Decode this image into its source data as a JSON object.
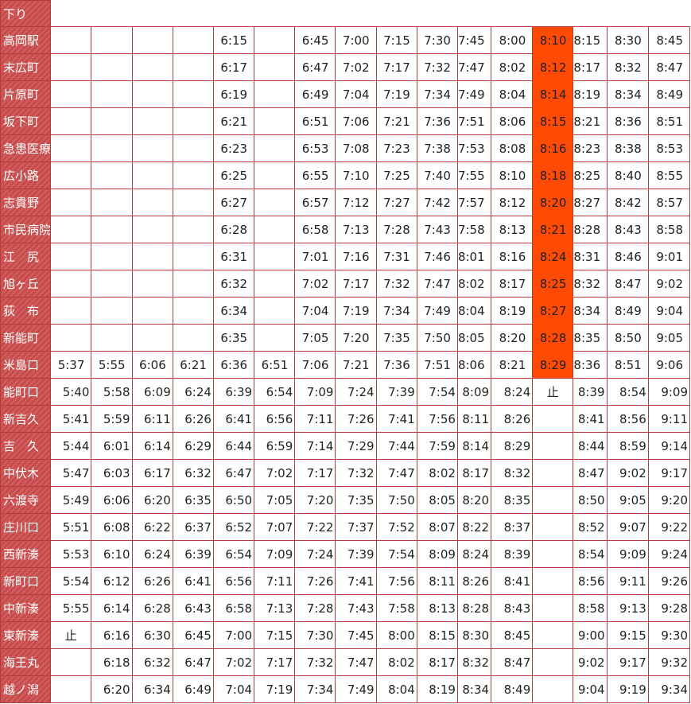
{
  "header": {
    "direction_label": "下り"
  },
  "stations": [
    "高岡駅",
    "末広町",
    "片原町",
    "坂下町",
    "急患医療",
    "広小路",
    "志貴野",
    "市民病院",
    "江　尻",
    "旭ヶ丘",
    "荻　布",
    "新能町",
    "米島口",
    "能町口",
    "新吉久",
    "吉　久",
    "中伏木",
    "六渡寺",
    "庄川口",
    "西新湊",
    "新町口",
    "中新湊",
    "東新湊",
    "海王丸",
    "越ノ潟"
  ],
  "rows": [
    [
      "",
      "",
      "",
      "",
      "6:15",
      "",
      "6:45",
      "7:00",
      "7:15",
      "7:30",
      "7:45",
      "8:00",
      "8:10",
      "8:15",
      "8:30",
      "8:45"
    ],
    [
      "",
      "",
      "",
      "",
      "6:17",
      "",
      "6:47",
      "7:02",
      "7:17",
      "7:32",
      "7:47",
      "8:02",
      "8:12",
      "8:17",
      "8:32",
      "8:47"
    ],
    [
      "",
      "",
      "",
      "",
      "6:19",
      "",
      "6:49",
      "7:04",
      "7:19",
      "7:34",
      "7:49",
      "8:04",
      "8:14",
      "8:19",
      "8:34",
      "8:49"
    ],
    [
      "",
      "",
      "",
      "",
      "6:21",
      "",
      "6:51",
      "7:06",
      "7:21",
      "7:36",
      "7:51",
      "8:06",
      "8:15",
      "8:21",
      "8:36",
      "8:51"
    ],
    [
      "",
      "",
      "",
      "",
      "6:23",
      "",
      "6:53",
      "7:08",
      "7:23",
      "7:38",
      "7:53",
      "8:08",
      "8:16",
      "8:23",
      "8:38",
      "8:53"
    ],
    [
      "",
      "",
      "",
      "",
      "6:25",
      "",
      "6:55",
      "7:10",
      "7:25",
      "7:40",
      "7:55",
      "8:10",
      "8:18",
      "8:25",
      "8:40",
      "8:55"
    ],
    [
      "",
      "",
      "",
      "",
      "6:27",
      "",
      "6:57",
      "7:12",
      "7:27",
      "7:42",
      "7:57",
      "8:12",
      "8:20",
      "8:27",
      "8:42",
      "8:57"
    ],
    [
      "",
      "",
      "",
      "",
      "6:28",
      "",
      "6:58",
      "7:13",
      "7:28",
      "7:43",
      "7:58",
      "8:13",
      "8:21",
      "8:28",
      "8:43",
      "8:58"
    ],
    [
      "",
      "",
      "",
      "",
      "6:31",
      "",
      "7:01",
      "7:16",
      "7:31",
      "7:46",
      "8:01",
      "8:16",
      "8:24",
      "8:31",
      "8:46",
      "9:01"
    ],
    [
      "",
      "",
      "",
      "",
      "6:32",
      "",
      "7:02",
      "7:17",
      "7:32",
      "7:47",
      "8:02",
      "8:17",
      "8:25",
      "8:32",
      "8:47",
      "9:02"
    ],
    [
      "",
      "",
      "",
      "",
      "6:34",
      "",
      "7:04",
      "7:19",
      "7:34",
      "7:49",
      "8:04",
      "8:19",
      "8:27",
      "8:34",
      "8:49",
      "9:04"
    ],
    [
      "",
      "",
      "",
      "",
      "6:35",
      "",
      "7:05",
      "7:20",
      "7:35",
      "7:50",
      "8:05",
      "8:20",
      "8:28",
      "8:35",
      "8:50",
      "9:05"
    ],
    [
      "5:37",
      "5:55",
      "6:06",
      "6:21",
      "6:36",
      "6:51",
      "7:06",
      "7:21",
      "7:36",
      "7:51",
      "8:06",
      "8:21",
      "8:29",
      "8:36",
      "8:51",
      "9:06"
    ],
    [
      "5:40",
      "5:58",
      "6:09",
      "6:24",
      "6:39",
      "6:54",
      "7:09",
      "7:24",
      "7:39",
      "7:54",
      "8:09",
      "8:24",
      "止",
      "8:39",
      "8:54",
      "9:09"
    ],
    [
      "5:41",
      "5:59",
      "6:11",
      "6:26",
      "6:41",
      "6:56",
      "7:11",
      "7:26",
      "7:41",
      "7:56",
      "8:11",
      "8:26",
      "",
      "8:41",
      "8:56",
      "9:11"
    ],
    [
      "5:44",
      "6:01",
      "6:14",
      "6:29",
      "6:44",
      "6:59",
      "7:14",
      "7:29",
      "7:44",
      "7:59",
      "8:14",
      "8:29",
      "",
      "8:44",
      "8:59",
      "9:14"
    ],
    [
      "5:47",
      "6:03",
      "6:17",
      "6:32",
      "6:47",
      "7:02",
      "7:17",
      "7:32",
      "7:47",
      "8:02",
      "8:17",
      "8:32",
      "",
      "8:47",
      "9:02",
      "9:17"
    ],
    [
      "5:49",
      "6:06",
      "6:20",
      "6:35",
      "6:50",
      "7:05",
      "7:20",
      "7:35",
      "7:50",
      "8:05",
      "8:20",
      "8:35",
      "",
      "8:50",
      "9:05",
      "9:20"
    ],
    [
      "5:51",
      "6:08",
      "6:22",
      "6:37",
      "6:52",
      "7:07",
      "7:22",
      "7:37",
      "7:52",
      "8:07",
      "8:22",
      "8:37",
      "",
      "8:52",
      "9:07",
      "9:22"
    ],
    [
      "5:53",
      "6:10",
      "6:24",
      "6:39",
      "6:54",
      "7:09",
      "7:24",
      "7:39",
      "7:54",
      "8:09",
      "8:24",
      "8:39",
      "",
      "8:54",
      "9:09",
      "9:24"
    ],
    [
      "5:54",
      "6:12",
      "6:26",
      "6:41",
      "6:56",
      "7:11",
      "7:26",
      "7:41",
      "7:56",
      "8:11",
      "8:26",
      "8:41",
      "",
      "8:56",
      "9:11",
      "9:26"
    ],
    [
      "5:55",
      "6:14",
      "6:28",
      "6:43",
      "6:58",
      "7:13",
      "7:28",
      "7:43",
      "7:58",
      "8:13",
      "8:28",
      "8:43",
      "",
      "8:58",
      "9:13",
      "9:28"
    ],
    [
      "止",
      "6:16",
      "6:30",
      "6:45",
      "7:00",
      "7:15",
      "7:30",
      "7:45",
      "8:00",
      "8:15",
      "8:30",
      "8:45",
      "",
      "9:00",
      "9:15",
      "9:30"
    ],
    [
      "",
      "6:18",
      "6:32",
      "6:47",
      "7:02",
      "7:17",
      "7:32",
      "7:47",
      "8:02",
      "8:17",
      "8:32",
      "8:47",
      "",
      "9:02",
      "9:17",
      "9:32"
    ],
    [
      "",
      "6:20",
      "6:34",
      "6:49",
      "7:04",
      "7:19",
      "7:34",
      "7:49",
      "8:04",
      "8:19",
      "8:34",
      "8:49",
      "",
      "9:04",
      "9:19",
      "9:34"
    ]
  ],
  "highlight": {
    "column": 12,
    "first_row": 0,
    "last_row": 12,
    "color": "#ff4a05"
  },
  "colors": {
    "station_bg": "#c94a4a",
    "border": "#b53a3a"
  }
}
